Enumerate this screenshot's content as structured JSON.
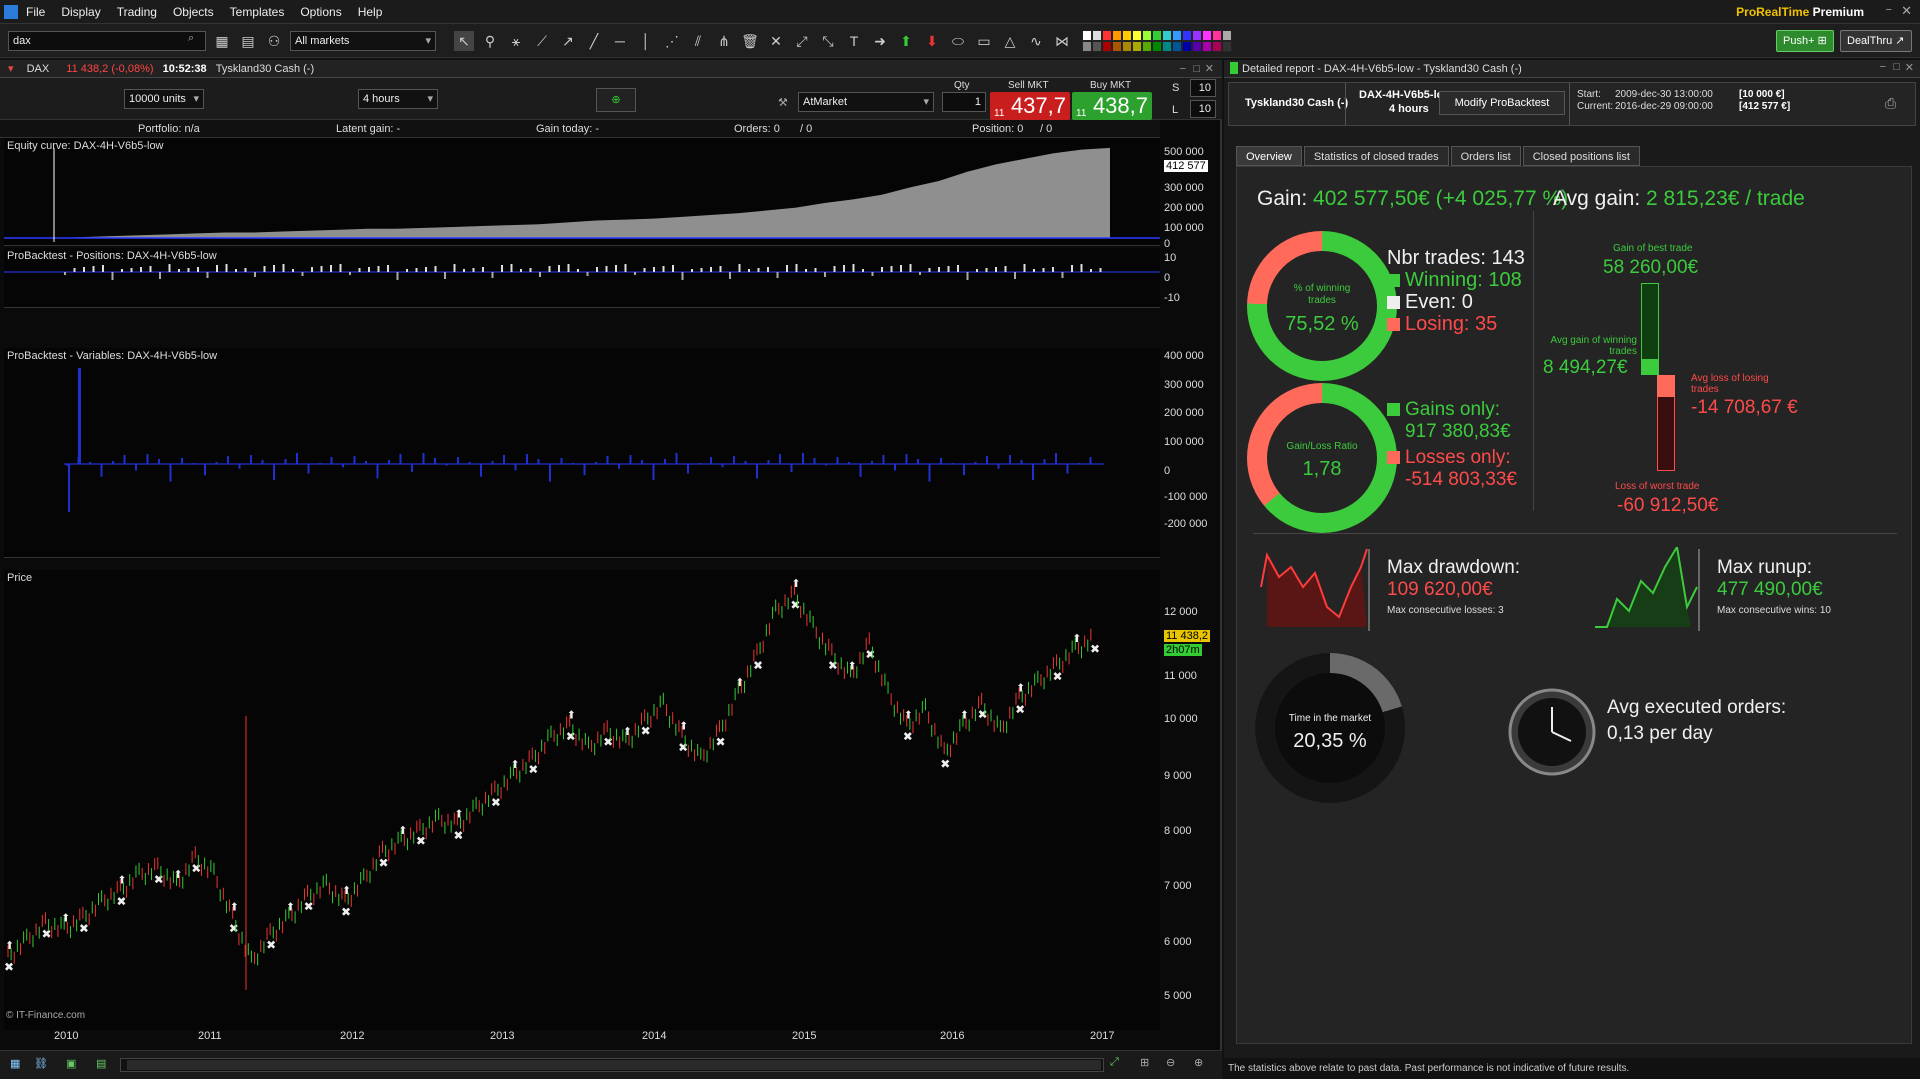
{
  "menu": {
    "items": [
      "File",
      "Display",
      "Trading",
      "Objects",
      "Templates",
      "Options",
      "Help"
    ],
    "brand_a": "ProRealTime",
    "brand_b": "Premium"
  },
  "toolbar": {
    "search_value": "dax",
    "market_filter": "All markets",
    "push_label": "Push+",
    "dealthru_label": "DealThru"
  },
  "chart_header": {
    "instrument": "DAX",
    "price_change": "11 438,2 (-0,08%)",
    "time": "10:52:38",
    "instrument_name": "Tyskland30 Cash (-)"
  },
  "order_bar": {
    "units": "10000 units",
    "timeframe": "4 hours",
    "order_type": "AtMarket",
    "qty_label": "Qty",
    "qty_value": "1",
    "sell_label": "Sell MKT",
    "buy_label": "Buy MKT",
    "sell_prefix": "11",
    "sell_price": "437,7",
    "buy_prefix": "11",
    "buy_price": "438,7",
    "s_label": "S",
    "l_label": "L",
    "s_value": "10",
    "l_value": "10"
  },
  "stats_row": {
    "portfolio": "Portfolio: n/a",
    "latent": "Latent gain: -",
    "today": "Gain today: -",
    "orders": "Orders: 0",
    "orders_sep": "/ 0",
    "position": "Position: 0",
    "position_sep": "/ 0"
  },
  "panels": {
    "equity_title": "Equity curve: DAX-4H-V6b5-low",
    "equity_axis": [
      "500 000",
      "412 577",
      "300 000",
      "200 000",
      "100 000",
      "0"
    ],
    "positions_title": "ProBacktest - Positions: DAX-4H-V6b5-low",
    "positions_axis": [
      "10",
      "0",
      "-10"
    ],
    "variables_title": "ProBacktest - Variables: DAX-4H-V6b5-low",
    "variables_axis": [
      "400 000",
      "300 000",
      "200 000",
      "100 000",
      "0",
      "-100 000",
      "-200 000"
    ],
    "price_title": "Price",
    "price_axis": [
      "12 000",
      "11 000",
      "10 000",
      "9 000",
      "8 000",
      "7 000",
      "6 000",
      "5 000"
    ],
    "price_badge": "11 438,2",
    "time_badge": "2h07m",
    "copyright": "© IT-Finance.com",
    "years": [
      "2010",
      "2011",
      "2012",
      "2013",
      "2014",
      "2015",
      "2016",
      "2017"
    ]
  },
  "report": {
    "window_title": "Detailed report - DAX-4H-V6b5-low - Tyskland30 Cash (-)",
    "head_instrument": "Tyskland30 Cash (-)",
    "head_system": "DAX-4H-V6b5-low",
    "head_tf": "4 hours",
    "modify_label": "Modify ProBacktest",
    "start_label": "Start:",
    "start_value": "2009-dec-30 13:00:00",
    "start_capital": "[10 000 €]",
    "current_label": "Current:",
    "current_value": "2016-dec-29 09:00:00",
    "current_capital": "[412 577 €]",
    "tabs": [
      "Overview",
      "Statistics of closed trades",
      "Orders list",
      "Closed positions list"
    ],
    "gain_label": "Gain:",
    "gain_value": "402 577,50€ (+4 025,77 %)",
    "avg_gain_label": "Avg gain:",
    "avg_gain_value": "2 815,23€ / trade",
    "win_pct_label": "% of winning trades",
    "win_pct_value": "75,52 %",
    "trades_label": "Nbr trades: 143",
    "winning_label": "Winning: 108",
    "even_label": "Even: 0",
    "losing_label": "Losing: 35",
    "ratio_label": "Gain/Loss Ratio",
    "ratio_value": "1,78",
    "gains_only_label": "Gains only:",
    "gains_only_value": "917 380,83€",
    "losses_only_label": "Losses only:",
    "losses_only_value": "-514 803,33€",
    "best_trade_label": "Gain of best trade",
    "best_trade_value": "58 260,00€",
    "avg_win_label": "Avg gain of winning trades",
    "avg_win_value": "8 494,27€",
    "avg_loss_label": "Avg loss of losing trades",
    "avg_loss_value": "-14 708,67 €",
    "worst_trade_label": "Loss of worst trade",
    "worst_trade_value": "-60 912,50€",
    "max_dd_label": "Max drawdown:",
    "max_dd_value": "109 620,00€",
    "max_dd_sub": "Max consecutive losses: 3",
    "max_ru_label": "Max runup:",
    "max_ru_value": "477 490,00€",
    "max_ru_sub": "Max consecutive wins: 10",
    "time_market_label": "Time in the market",
    "time_market_value": "20,35 %",
    "time_market_fraction": 0.2035,
    "avg_orders_label": "Avg executed orders:",
    "avg_orders_value": "0,13 per day",
    "win_fraction": 0.7552,
    "ratio_fraction": 0.64,
    "footer": "The statistics above relate to past data. Past performance is not indicative of future results."
  },
  "colors": {
    "green": "#3ccb3c",
    "red": "#ff4a4a",
    "equity": "#8f8f8f",
    "blue": "#2b3aff",
    "brand": "#f2c200"
  },
  "equity_series": [
    0,
    0.01,
    0.02,
    0.03,
    0.04,
    0.05,
    0.06,
    0.06,
    0.07,
    0.08,
    0.09,
    0.1,
    0.1,
    0.11,
    0.12,
    0.13,
    0.14,
    0.15,
    0.17,
    0.19,
    0.2,
    0.21,
    0.23,
    0.25,
    0.27,
    0.3,
    0.33,
    0.38,
    0.42,
    0.47,
    0.55,
    0.62,
    0.72,
    0.8,
    0.86,
    0.92,
    0.96,
    0.98
  ],
  "price_series": [
    5600,
    5900,
    6200,
    6100,
    6300,
    6600,
    6800,
    7100,
    7200,
    6900,
    7400,
    7100,
    6300,
    5500,
    6000,
    6300,
    6700,
    6900,
    6600,
    7000,
    7500,
    7700,
    7900,
    8100,
    8000,
    8300,
    8600,
    8900,
    9200,
    9600,
    9800,
    9400,
    9700,
    9500,
    9900,
    10200,
    9600,
    9200,
    9700,
    10400,
    11100,
    11900,
    12200,
    11600,
    11100,
    10700,
    11300,
    10400,
    9800,
    10100,
    9300,
    9800,
    10200,
    9700,
    10300,
    10600,
    10900,
    11200,
    11400
  ]
}
